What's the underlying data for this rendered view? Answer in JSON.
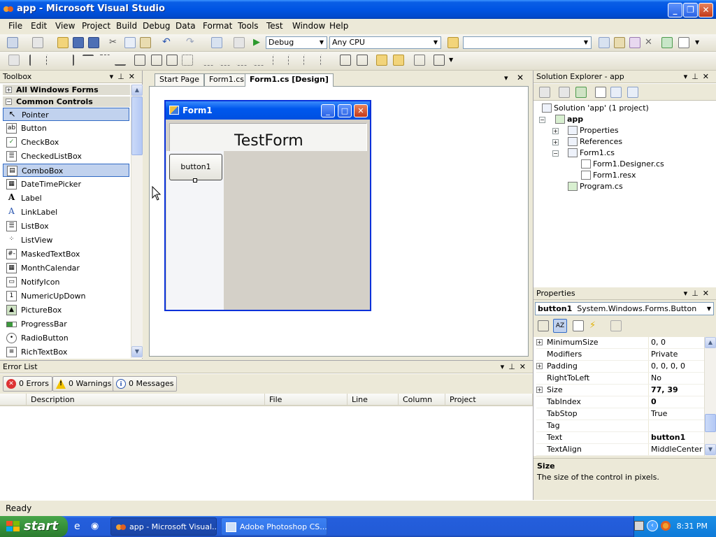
{
  "window": {
    "title": "app - Microsoft Visual Studio"
  },
  "menu": [
    "File",
    "Edit",
    "View",
    "Project",
    "Build",
    "Debug",
    "Data",
    "Format",
    "Tools",
    "Test",
    "Window",
    "Help"
  ],
  "toolbar": {
    "config": "Debug",
    "platform": "Any CPU",
    "find": ""
  },
  "toolbox": {
    "title": "Toolbox",
    "categories": [
      "All Windows Forms",
      "Common Controls"
    ],
    "items": [
      "Pointer",
      "Button",
      "CheckBox",
      "CheckedListBox",
      "ComboBox",
      "DateTimePicker",
      "Label",
      "LinkLabel",
      "ListBox",
      "ListView",
      "MaskedTextBox",
      "MonthCalendar",
      "NotifyIcon",
      "NumericUpDown",
      "PictureBox",
      "ProgressBar",
      "RadioButton",
      "RichTextBox"
    ]
  },
  "tabs": [
    "Start Page",
    "Form1.cs",
    "Form1.cs [Design]"
  ],
  "form": {
    "title": "Form1",
    "header": "TestForm",
    "button": "button1"
  },
  "solution": {
    "title": "Solution Explorer - app",
    "root": "Solution 'app' (1 project)",
    "project": "app",
    "nodes": [
      "Properties",
      "References",
      "Form1.cs",
      "Form1.Designer.cs",
      "Form1.resx",
      "Program.cs"
    ]
  },
  "properties": {
    "title": "Properties",
    "object_name": "button1",
    "object_type": "System.Windows.Forms.Button",
    "rows": [
      {
        "name": "MinimumSize",
        "value": "0, 0"
      },
      {
        "name": "Modifiers",
        "value": "Private"
      },
      {
        "name": "Padding",
        "value": "0, 0, 0, 0"
      },
      {
        "name": "RightToLeft",
        "value": "No"
      },
      {
        "name": "Size",
        "value": "77, 39"
      },
      {
        "name": "TabIndex",
        "value": "0"
      },
      {
        "name": "TabStop",
        "value": "True"
      },
      {
        "name": "Tag",
        "value": ""
      },
      {
        "name": "Text",
        "value": "button1"
      },
      {
        "name": "TextAlign",
        "value": "MiddleCenter"
      }
    ],
    "desc_title": "Size",
    "desc_text": "The size of the control in pixels."
  },
  "errorlist": {
    "title": "Error List",
    "errors": "0 Errors",
    "warnings": "0 Warnings",
    "messages": "0 Messages",
    "columns": [
      "Description",
      "File",
      "Line",
      "Column",
      "Project"
    ]
  },
  "status": "Ready",
  "taskbar": {
    "start": "start",
    "tasks": [
      "app - Microsoft Visual...",
      "Adobe Photoshop CS..."
    ],
    "clock": "8:31 PM"
  },
  "colors": {
    "xp_blue": "#0054e3",
    "selection": "#c1d2ee",
    "start_green": "#36913a"
  }
}
